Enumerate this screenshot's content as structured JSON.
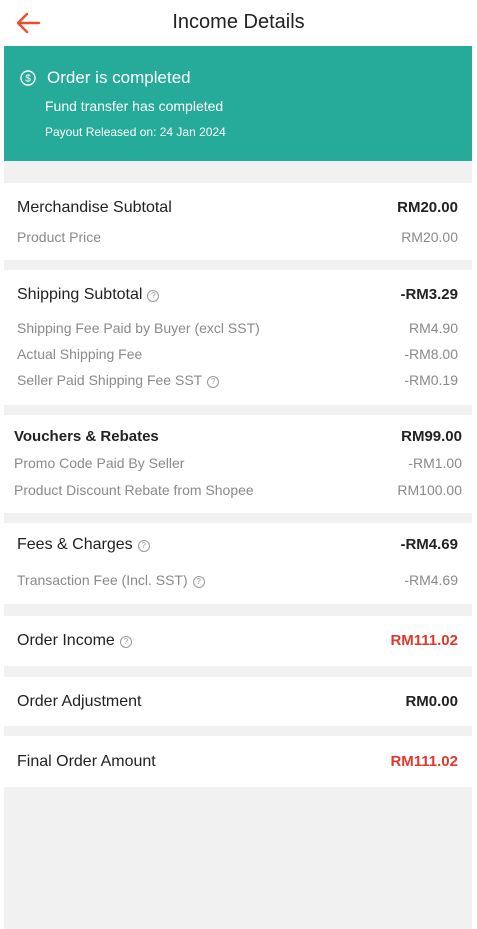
{
  "header": {
    "title": "Income Details"
  },
  "banner": {
    "status": "Order is completed",
    "subtitle": "Fund transfer has completed",
    "payout": "Payout Released on: 24 Jan 2024",
    "color": "#26aa99"
  },
  "merchandise": {
    "title": "Merchandise Subtotal",
    "total": "RM20.00",
    "items": [
      {
        "label": "Product Price",
        "value": "RM20.00"
      }
    ]
  },
  "shipping": {
    "title": "Shipping Subtotal",
    "total": "-RM3.29",
    "items": [
      {
        "label": "Shipping Fee Paid by Buyer (excl SST)",
        "value": "RM4.90"
      },
      {
        "label": "Actual Shipping Fee",
        "value": "-RM8.00"
      },
      {
        "label": "Seller Paid Shipping Fee SST",
        "value": "-RM0.19"
      }
    ]
  },
  "vouchers": {
    "title": "Vouchers & Rebates",
    "total": "RM99.00",
    "items": [
      {
        "label": "Promo Code Paid By Seller",
        "value": "-RM1.00"
      },
      {
        "label": "Product Discount Rebate from Shopee",
        "value": "RM100.00"
      }
    ]
  },
  "fees": {
    "title": "Fees & Charges",
    "total": "-RM4.69",
    "items": [
      {
        "label": "Transaction Fee (Incl. SST)",
        "value": "-RM4.69"
      }
    ]
  },
  "order_income": {
    "title": "Order Income",
    "value": "RM111.02"
  },
  "order_adjustment": {
    "title": "Order Adjustment",
    "value": "RM0.00"
  },
  "final_order_amount": {
    "title": "Final Order Amount",
    "value": "RM111.02"
  },
  "colors": {
    "accent": "#ee4d2d",
    "highlight": "#e1372c",
    "divider": "#f1f1f1"
  }
}
